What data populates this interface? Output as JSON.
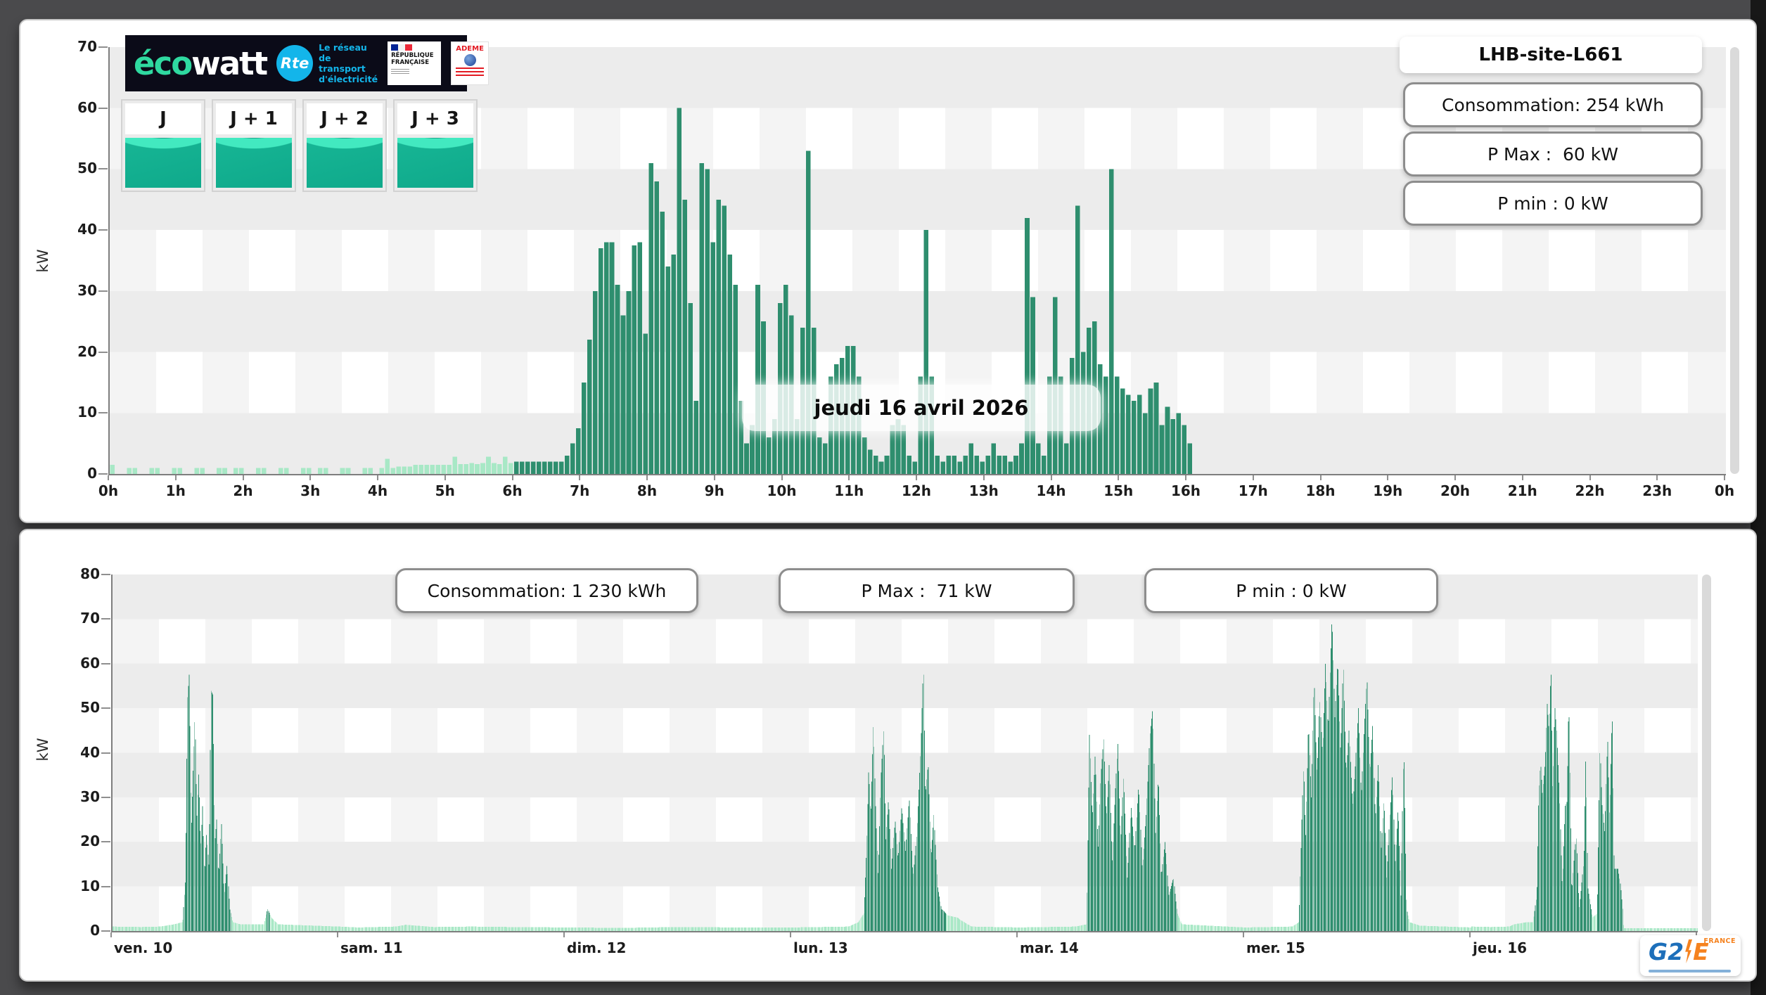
{
  "page": {
    "background": "#4a4a4c"
  },
  "branding": {
    "ecowatt_eco": "éco",
    "ecowatt_watt": "watt",
    "rte": "Rte",
    "rte_tagline_1": "Le réseau",
    "rte_tagline_2": "de transport",
    "rte_tagline_3": "d'électricité",
    "republique_1": "RÉPUBLIQUE",
    "republique_2": "FRANÇAISE",
    "ademe": "ADEME",
    "g2e_main": "G2",
    "g2e_e": "E",
    "g2e_france": "FRANCE"
  },
  "day_buttons": [
    {
      "label": "J"
    },
    {
      "label": "J + 1"
    },
    {
      "label": "J + 2"
    },
    {
      "label": "J + 3"
    }
  ],
  "chart_data": [
    {
      "type": "bar",
      "title": "LHB-site-L661",
      "annotation": "jeudi 16 avril 2026",
      "ylabel": "kW",
      "ylim": [
        0,
        70
      ],
      "yticks": [
        0,
        10,
        20,
        30,
        40,
        50,
        60,
        70
      ],
      "xtick_labels": [
        "0h",
        "1h",
        "2h",
        "3h",
        "4h",
        "5h",
        "6h",
        "7h",
        "8h",
        "9h",
        "10h",
        "11h",
        "12h",
        "13h",
        "14h",
        "15h",
        "16h",
        "17h",
        "18h",
        "19h",
        "20h",
        "21h",
        "22h",
        "23h",
        "0h"
      ],
      "interval_minutes": 5,
      "start_hour": 0,
      "pale_before_hour": 6,
      "colors": {
        "pale": "#a8e8c6",
        "dark": "#2e8e6e"
      },
      "stats": {
        "consumption": "Consommation: 254 kWh",
        "pmax": "P Max :  60 kW",
        "pmin": "P min : 0 kW"
      },
      "values": [
        1.5,
        0,
        0,
        1,
        1,
        0,
        0,
        1,
        1,
        0,
        0,
        1,
        1,
        0,
        0,
        1,
        1,
        0,
        0,
        1,
        1,
        0,
        1,
        1,
        0,
        0,
        1,
        1,
        0,
        0,
        1,
        1,
        0,
        0,
        1,
        1,
        0,
        1,
        1,
        0,
        0,
        1,
        1,
        0,
        0,
        1,
        1,
        0,
        1,
        2.5,
        1,
        1.2,
        1.2,
        1.2,
        1.5,
        1.5,
        1.5,
        1.5,
        1.5,
        1.5,
        1.5,
        2.8,
        1.6,
        1.6,
        1.8,
        1.6,
        1.8,
        2.8,
        1.8,
        1.6,
        2.8,
        1.8,
        2,
        2,
        2,
        2,
        2,
        2,
        2,
        2,
        2,
        3,
        5,
        7.5,
        15,
        22,
        30,
        37,
        38,
        38,
        31,
        26,
        30,
        37.5,
        38,
        23,
        51,
        48,
        43,
        34,
        36,
        60,
        45,
        28,
        12,
        51,
        50,
        38,
        45,
        44,
        36,
        31,
        12,
        5,
        8,
        31,
        25,
        6,
        9,
        28,
        31,
        26,
        9,
        24,
        53,
        24,
        6,
        5,
        16,
        18,
        19,
        21,
        21,
        16,
        6,
        4,
        3,
        2,
        3,
        8,
        9,
        8,
        3,
        2,
        16,
        40,
        16,
        3,
        2,
        3,
        3,
        2,
        3,
        5,
        3,
        2,
        3,
        5,
        3,
        3,
        2,
        3,
        5,
        42,
        29,
        5,
        3,
        16,
        29,
        16,
        5,
        19,
        44,
        20,
        24,
        25,
        18,
        16,
        50,
        16,
        14,
        13,
        12,
        13,
        10,
        14,
        15,
        8,
        11,
        9,
        10,
        8,
        5
      ]
    },
    {
      "type": "bar",
      "ylabel": "kW",
      "ylim": [
        0,
        80
      ],
      "yticks": [
        0,
        10,
        20,
        30,
        40,
        50,
        60,
        70,
        80
      ],
      "xtick_labels": [
        "ven. 10",
        "sam. 11",
        "dim. 12",
        "lun. 13",
        "mar. 14",
        "mer. 15",
        "jeu. 16"
      ],
      "interval_minutes": 5,
      "pale_threshold": 4,
      "colors": {
        "pale": "#a8e8c6",
        "dark": "#2e8e6e"
      },
      "stats": {
        "consumption": "Consommation: 1 230 kWh",
        "pmax": "P Max :  71 kW",
        "pmin": "P min : 0 kW"
      },
      "days": [
        {
          "label": "ven. 10",
          "points": [
            [
              0,
              1
            ],
            [
              3,
              0.9
            ],
            [
              5,
              1
            ],
            [
              6.5,
              1.5
            ],
            [
              7.4,
              2
            ],
            [
              7.7,
              12
            ],
            [
              7.9,
              52
            ],
            [
              8.1,
              58
            ],
            [
              8.3,
              22
            ],
            [
              8.5,
              36
            ],
            [
              8.7,
              49
            ],
            [
              8.9,
              25
            ],
            [
              9.1,
              36
            ],
            [
              9.3,
              18
            ],
            [
              9.5,
              28
            ],
            [
              9.7,
              12
            ],
            [
              9.9,
              22
            ],
            [
              10.2,
              14
            ],
            [
              10.4,
              54
            ],
            [
              10.6,
              53
            ],
            [
              10.8,
              20
            ],
            [
              11,
              25
            ],
            [
              11.2,
              12
            ],
            [
              11.5,
              24
            ],
            [
              11.8,
              8
            ],
            [
              12.1,
              15
            ],
            [
              12.4,
              5
            ],
            [
              12.7,
              2
            ],
            [
              13.5,
              1.5
            ],
            [
              16,
              1.5
            ],
            [
              16.4,
              5
            ],
            [
              16.8,
              3
            ],
            [
              17.5,
              1.5
            ],
            [
              24,
              1
            ]
          ]
        },
        {
          "label": "sam. 11",
          "points": [
            [
              0,
              1
            ],
            [
              2,
              0.8
            ],
            [
              6,
              1
            ],
            [
              7,
              1.4
            ],
            [
              10,
              0.9
            ],
            [
              14,
              1
            ],
            [
              18,
              0.9
            ],
            [
              24,
              0.8
            ]
          ]
        },
        {
          "label": "dim. 12",
          "points": [
            [
              0,
              0.8
            ],
            [
              6,
              0.7
            ],
            [
              12,
              0.9
            ],
            [
              18,
              0.8
            ],
            [
              24,
              0.8
            ]
          ]
        },
        {
          "label": "lun. 13",
          "points": [
            [
              0,
              0.8
            ],
            [
              6,
              1
            ],
            [
              7,
              2
            ],
            [
              7.6,
              4
            ],
            [
              7.9,
              20
            ],
            [
              8.1,
              37
            ],
            [
              8.3,
              25
            ],
            [
              8.6,
              47
            ],
            [
              8.8,
              30
            ],
            [
              9.1,
              12
            ],
            [
              9.4,
              35
            ],
            [
              9.7,
              46
            ],
            [
              9.9,
              20
            ],
            [
              10.2,
              30
            ],
            [
              10.5,
              14
            ],
            [
              10.9,
              25
            ],
            [
              11.2,
              16
            ],
            [
              11.6,
              28
            ],
            [
              12,
              18
            ],
            [
              12.4,
              30
            ],
            [
              12.8,
              12
            ],
            [
              13.2,
              22
            ],
            [
              13.6,
              40
            ],
            [
              13.9,
              60
            ],
            [
              14.1,
              30
            ],
            [
              14.4,
              38
            ],
            [
              14.7,
              16
            ],
            [
              15,
              26
            ],
            [
              15.4,
              10
            ],
            [
              15.8,
              5
            ],
            [
              16.5,
              3.5
            ],
            [
              17.5,
              3
            ],
            [
              18.2,
              2
            ],
            [
              19,
              1
            ],
            [
              24,
              0.8
            ]
          ]
        },
        {
          "label": "mar. 14",
          "points": [
            [
              0,
              0.8
            ],
            [
              6,
              1
            ],
            [
              7.2,
              1.5
            ],
            [
              7.5,
              44
            ],
            [
              7.8,
              25
            ],
            [
              8.1,
              40
            ],
            [
              8.4,
              18
            ],
            [
              8.7,
              35
            ],
            [
              9,
              43
            ],
            [
              9.3,
              25
            ],
            [
              9.6,
              38
            ],
            [
              9.9,
              15
            ],
            [
              10.2,
              30
            ],
            [
              10.5,
              42
            ],
            [
              10.8,
              20
            ],
            [
              11.1,
              35
            ],
            [
              11.5,
              12
            ],
            [
              11.9,
              28
            ],
            [
              12.3,
              18
            ],
            [
              12.7,
              33
            ],
            [
              13.1,
              14
            ],
            [
              13.5,
              26
            ],
            [
              13.9,
              44
            ],
            [
              14.2,
              50
            ],
            [
              14.5,
              22
            ],
            [
              14.8,
              35
            ],
            [
              15.1,
              12
            ],
            [
              15.5,
              20
            ],
            [
              15.9,
              8
            ],
            [
              16.4,
              12
            ],
            [
              16.8,
              4
            ],
            [
              17.3,
              1.5
            ],
            [
              24,
              0.8
            ]
          ]
        },
        {
          "label": "mer. 15",
          "points": [
            [
              0,
              0.8
            ],
            [
              5,
              1
            ],
            [
              5.7,
              2
            ],
            [
              6,
              25
            ],
            [
              6.2,
              38
            ],
            [
              6.4,
              20
            ],
            [
              6.7,
              47
            ],
            [
              7,
              30
            ],
            [
              7.3,
              57
            ],
            [
              7.6,
              35
            ],
            [
              7.9,
              52
            ],
            [
              8.2,
              40
            ],
            [
              8.5,
              60
            ],
            [
              8.8,
              45
            ],
            [
              9.2,
              71
            ],
            [
              9.5,
              48
            ],
            [
              9.8,
              61
            ],
            [
              10.1,
              40
            ],
            [
              10.4,
              60
            ],
            [
              10.7,
              35
            ],
            [
              11,
              45
            ],
            [
              11.4,
              28
            ],
            [
              11.7,
              38
            ],
            [
              12,
              50
            ],
            [
              12.3,
              30
            ],
            [
              12.6,
              45
            ],
            [
              12.9,
              57
            ],
            [
              13.2,
              35
            ],
            [
              13.5,
              46
            ],
            [
              13.8,
              25
            ],
            [
              14.1,
              38
            ],
            [
              14.4,
              18
            ],
            [
              14.7,
              30
            ],
            [
              15,
              12
            ],
            [
              15.3,
              25
            ],
            [
              15.6,
              35
            ],
            [
              15.9,
              15
            ],
            [
              16.2,
              28
            ],
            [
              16.5,
              8
            ],
            [
              16.8,
              42
            ],
            [
              17.1,
              5
            ],
            [
              17.4,
              2
            ],
            [
              18.5,
              1.2
            ],
            [
              24,
              0.8
            ]
          ]
        },
        {
          "label": "jeu. 16",
          "points": [
            [
              0,
              1
            ],
            [
              2,
              0.9
            ],
            [
              4,
              1
            ],
            [
              4.5,
              1.5
            ],
            [
              5.9,
              2
            ],
            [
              6.5,
              2
            ],
            [
              6.9,
              8
            ],
            [
              7.1,
              30
            ],
            [
              7.3,
              38
            ],
            [
              7.5,
              31
            ],
            [
              7.8,
              38
            ],
            [
              8,
              51
            ],
            [
              8.2,
              45
            ],
            [
              8.4,
              60
            ],
            [
              8.6,
              30
            ],
            [
              8.8,
              51
            ],
            [
              9,
              45
            ],
            [
              9.3,
              31
            ],
            [
              9.6,
              10
            ],
            [
              9.9,
              28
            ],
            [
              10.1,
              29
            ],
            [
              10.3,
              53
            ],
            [
              10.6,
              8
            ],
            [
              10.9,
              18
            ],
            [
              11.1,
              21
            ],
            [
              11.4,
              5
            ],
            [
              11.9,
              16
            ],
            [
              12.1,
              40
            ],
            [
              12.3,
              10
            ],
            [
              12.8,
              3
            ],
            [
              13.3,
              4
            ],
            [
              13.6,
              42
            ],
            [
              13.8,
              29
            ],
            [
              14.1,
              22
            ],
            [
              14.4,
              44
            ],
            [
              14.6,
              25
            ],
            [
              14.9,
              50
            ],
            [
              15.1,
              14
            ],
            [
              15.5,
              14
            ],
            [
              15.8,
              10
            ],
            [
              16,
              5
            ],
            [
              16.1,
              0.6
            ],
            [
              20,
              0.6
            ],
            [
              24,
              0.6
            ]
          ]
        }
      ]
    }
  ]
}
